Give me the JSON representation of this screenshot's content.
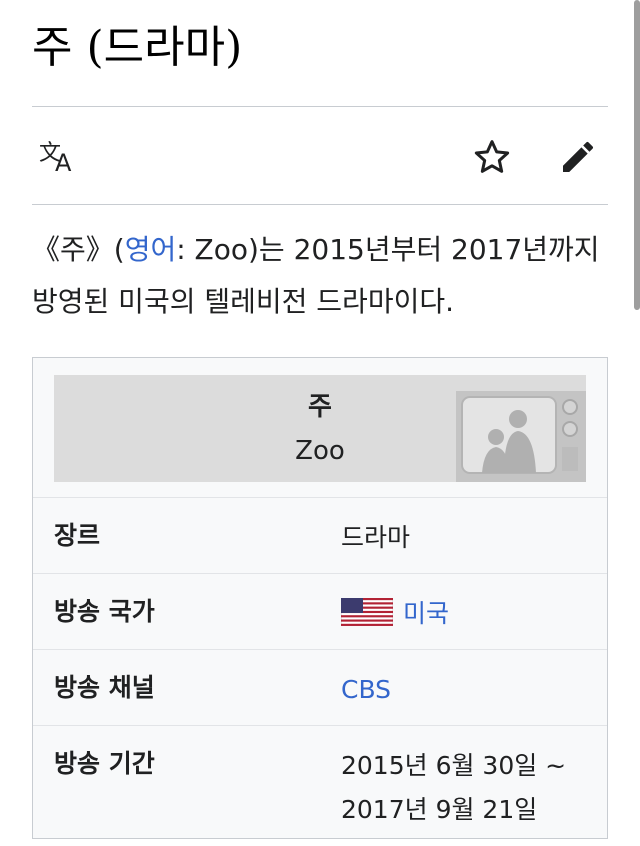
{
  "article": {
    "title": "주 (드라마)"
  },
  "toolbar": {
    "language_icon": "translate-icon",
    "watch_icon": "star-icon",
    "edit_icon": "pencil-icon"
  },
  "intro": {
    "title_open": "《주》(",
    "lang_link": "영어",
    "title_rest": ": Zoo)는 2015년부터 2017년까지",
    "line2": "방영된 미국의 텔레비전 드라마이다."
  },
  "infobox": {
    "title": "주",
    "subtitle": "Zoo",
    "rows": [
      {
        "label": "장르",
        "value": "드라마"
      },
      {
        "label": "방송 국가",
        "value": "미국"
      },
      {
        "label": "방송 채널",
        "value": "CBS"
      },
      {
        "label": "방송 기간",
        "value_line1": "2015년 6월 30일 ~",
        "value_line2": "2017년 9월 21일"
      }
    ]
  },
  "colors": {
    "link": "#3366cc",
    "text": "#202122",
    "divider": "#c8ccd1",
    "infobox_bg": "#f8f9fa",
    "infobox_header_bg": "#dcdcdc"
  }
}
